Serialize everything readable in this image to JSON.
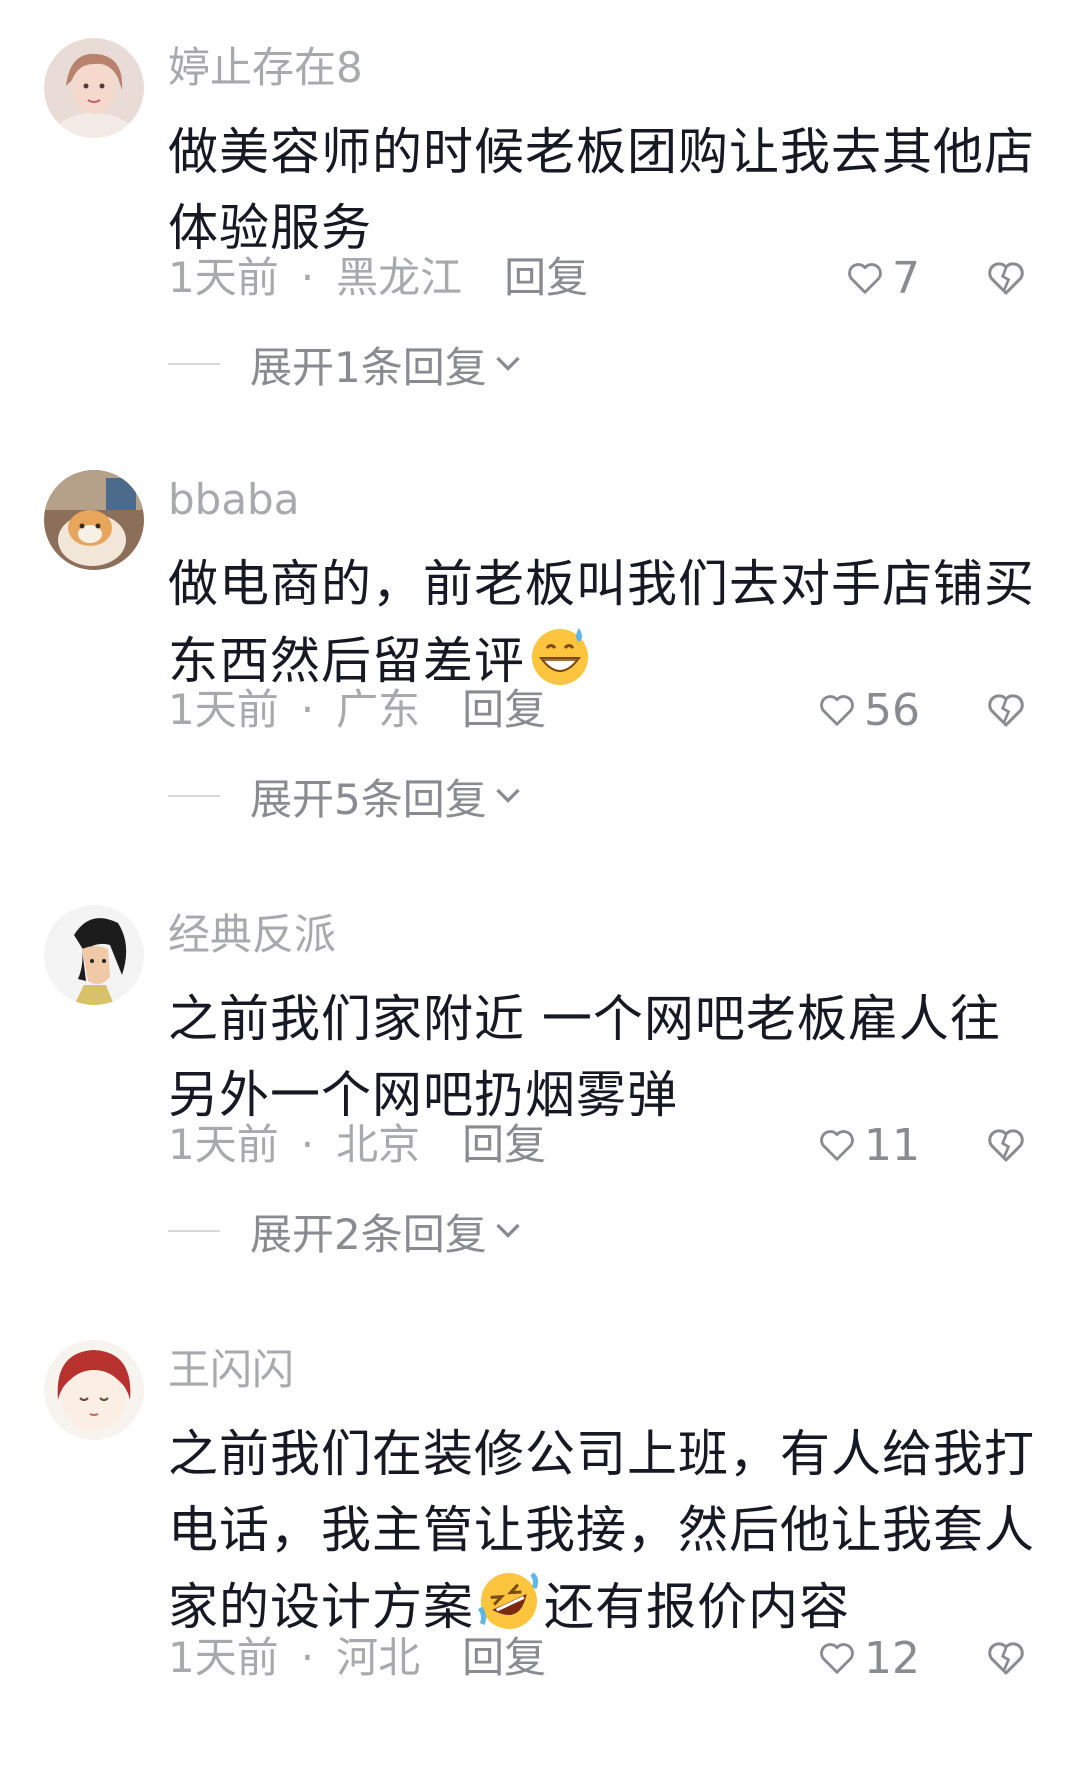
{
  "comments": [
    {
      "username": "婷止存在8",
      "text": "做美容师的时候老板团购让我去其他店体验服务",
      "time": "1天前",
      "location": "黑龙江",
      "reply_label": "回复",
      "likes": "7",
      "expand_label": "展开1条回复"
    },
    {
      "username": "bbaba",
      "text": "做电商的，前老板叫我们去对手店铺买东西然后留差评",
      "time": "1天前",
      "location": "广东",
      "reply_label": "回复",
      "likes": "56",
      "expand_label": "展开5条回复"
    },
    {
      "username": "经典反派",
      "text": "之前我们家附近 一个网吧老板雇人往另外一个网吧扔烟雾弹",
      "time": "1天前",
      "location": "北京",
      "reply_label": "回复",
      "likes": "11",
      "expand_label": "展开2条回复"
    },
    {
      "username": "王闪闪",
      "text_part1": "之前我们在装修公司上班，有人给我打电话，我主管让我接，然后他让我套人家的设计方案",
      "text_part2": "还有报价内容",
      "time": "1天前",
      "location": "河北",
      "reply_label": "回复",
      "likes": "12"
    }
  ],
  "icons": {
    "like": "heart-outline-icon",
    "dislike": "broken-heart-icon",
    "expand": "chevron-down-icon",
    "emoji_sweat": "grinning-sweat-emoji",
    "emoji_rofl": "rolling-laughing-emoji"
  }
}
